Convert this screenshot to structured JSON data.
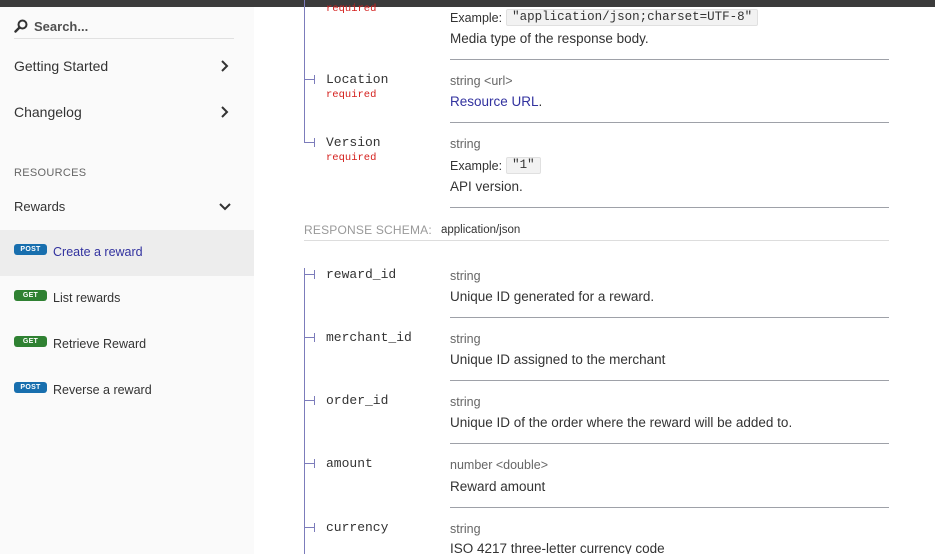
{
  "sidebar": {
    "search_placeholder": "Search...",
    "nav": [
      {
        "label": "Getting Started",
        "icon": "chevron-right-icon"
      },
      {
        "label": "Changelog",
        "icon": "chevron-right-icon"
      }
    ],
    "section_title": "RESOURCES",
    "group": {
      "label": "Rewards",
      "icon": "chevron-down-icon"
    },
    "operations": [
      {
        "method": "POST",
        "label": "Create a reward",
        "active": true
      },
      {
        "method": "GET",
        "label": "List rewards",
        "active": false
      },
      {
        "method": "GET",
        "label": "Retrieve Reward",
        "active": false
      },
      {
        "method": "POST",
        "label": "Reverse a reward",
        "active": false
      }
    ]
  },
  "headers": {
    "required_text": "required",
    "example_label": "Example:",
    "content_type": {
      "example": "\"application/json;charset=UTF-8\"",
      "description": "Media type of the response body."
    },
    "location": {
      "name": "Location",
      "type": "string <url>",
      "description_link": "Resource URL",
      "description_suffix": "."
    },
    "version": {
      "name": "Version",
      "type": "string",
      "example": "\"1\"",
      "description": "API version."
    }
  },
  "response_schema": {
    "label": "RESPONSE SCHEMA:",
    "content_type": "application/json",
    "fields": [
      {
        "name": "reward_id",
        "type": "string",
        "description": "Unique ID generated for a reward."
      },
      {
        "name": "merchant_id",
        "type": "string",
        "description": "Unique ID assigned to the merchant"
      },
      {
        "name": "order_id",
        "type": "string",
        "description": "Unique ID of the order where the reward will be added to."
      },
      {
        "name": "amount",
        "type": "number <double>",
        "description": "Reward amount"
      },
      {
        "name": "currency",
        "type": "string",
        "description": "ISO 4217 three-letter currency code"
      }
    ]
  },
  "colors": {
    "accent": "#32329f",
    "required": "#d41f1c",
    "post_badge": "#186fae",
    "get_badge": "#2f8132",
    "active_bg": "#ededed"
  }
}
